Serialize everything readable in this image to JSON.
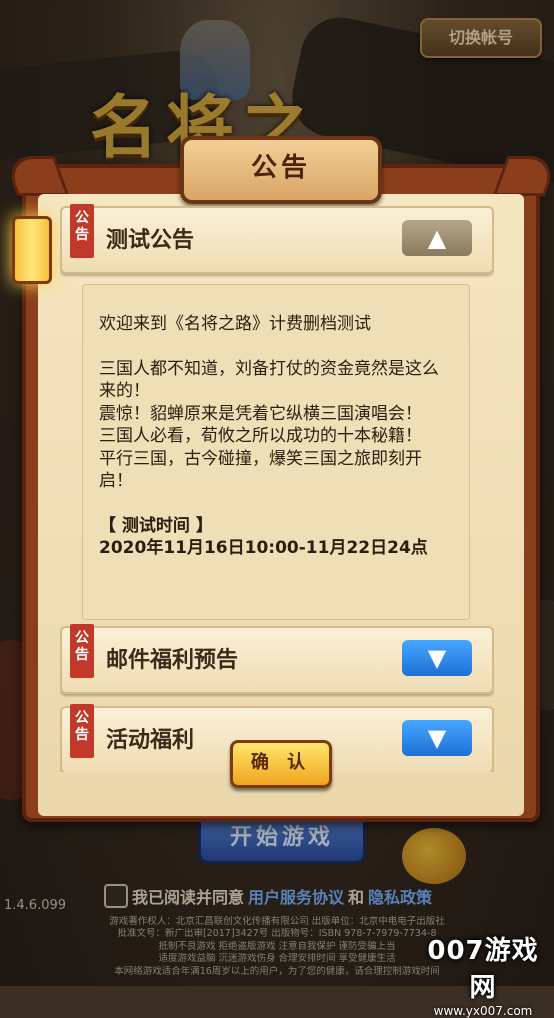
{
  "top_bar": {
    "switch_account": "切换帐号"
  },
  "background": {
    "logo_text": "名将之路",
    "start_button": "开始游戏",
    "version": "1.4.6.099",
    "agree": {
      "prefix": "我已阅读并同意",
      "link1": "用户服务协议",
      "and": "和",
      "link2": "隐私政策"
    },
    "legal_lines": [
      "游戏著作权人：北京汇昌联创文化传播有限公司 出版单位：北京中电电子出版社",
      "批准文号：新广出审[2017]3427号 出版物号：ISBN 978-7-7979-7734-8",
      "抵制不良游戏 拒绝盗版游戏 注意自我保护 谨防受骗上当",
      "适度游戏益脑 沉迷游戏伤身 合理安排时间 享受健康生活",
      "本网络游戏适合年满16周岁以上的用户，为了您的健康，请合理控制游戏时间"
    ]
  },
  "dialog": {
    "title": "公告",
    "tag_text": "公告",
    "confirm": "确 认",
    "notices": [
      {
        "title": "测试公告",
        "expanded": true,
        "toggle_icon": "▲",
        "body": [
          "欢迎来到《名将之路》计费删档测试",
          "",
          "三国人都不知道，刘备打仗的资金竟然是这么来的！",
          "震惊！貂蝉原来是凭着它纵横三国演唱会！",
          "三国人必看，荀攸之所以成功的十本秘籍！",
          "平行三国，古今碰撞，爆笑三国之旅即刻开启！",
          "",
          "【 测试时间 】",
          "2020年11月16日10:00-11月22日24点"
        ]
      },
      {
        "title": "邮件福利预告",
        "expanded": false,
        "toggle_icon": "▼"
      },
      {
        "title": "活动福利",
        "expanded": false,
        "toggle_icon": "▼"
      }
    ]
  },
  "watermark": {
    "brand": "007游戏网",
    "url": "www.yx007.com"
  },
  "colors": {
    "frame": "#8a3e1c",
    "parchment": "#f5e6c2",
    "tag": "#c0392b",
    "expand": "#2f8cf0",
    "confirm": "#f6c23c"
  }
}
